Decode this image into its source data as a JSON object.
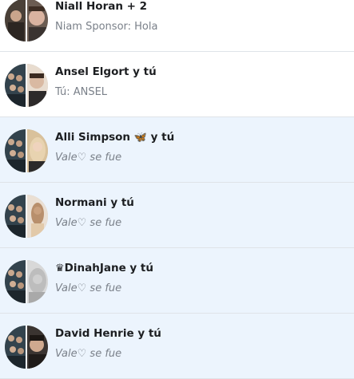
{
  "conversations": [
    {
      "title": "Niall Horan + 2",
      "snippet": "Niam Sponsor: Hola",
      "unread": false,
      "colors": {
        "left": "#4a4038",
        "right": "#c9a189"
      }
    },
    {
      "title": "Ansel Elgort y tú",
      "snippet": "Tú: ANSEL",
      "unread": false,
      "colors": {
        "left": "#2b3b46",
        "right": "#d8c2ae"
      }
    },
    {
      "title_prefix": "Alli Simpson ",
      "title_suffix": " y tú",
      "emoji": "🦋",
      "snippet": "Vale♡ se fue",
      "unread": true,
      "colors": {
        "left": "#2b3b46",
        "right": "#d9c19b"
      }
    },
    {
      "title": "Normani y tú",
      "snippet": "Vale♡ se fue",
      "unread": true,
      "colors": {
        "left": "#2b3b46",
        "right": "#c5a083"
      }
    },
    {
      "title_prefix": "",
      "title_suffix": "DinahJane y tú",
      "emoji": "♛",
      "snippet": "Vale♡ se fue",
      "unread": true,
      "colors": {
        "left": "#2b3b46",
        "right": "#d4d4d4"
      }
    },
    {
      "title": "David Henrie y tú",
      "snippet": "Vale♡ se fue",
      "unread": true,
      "colors": {
        "left": "#2b3b46",
        "right": "#3a3431"
      }
    }
  ]
}
